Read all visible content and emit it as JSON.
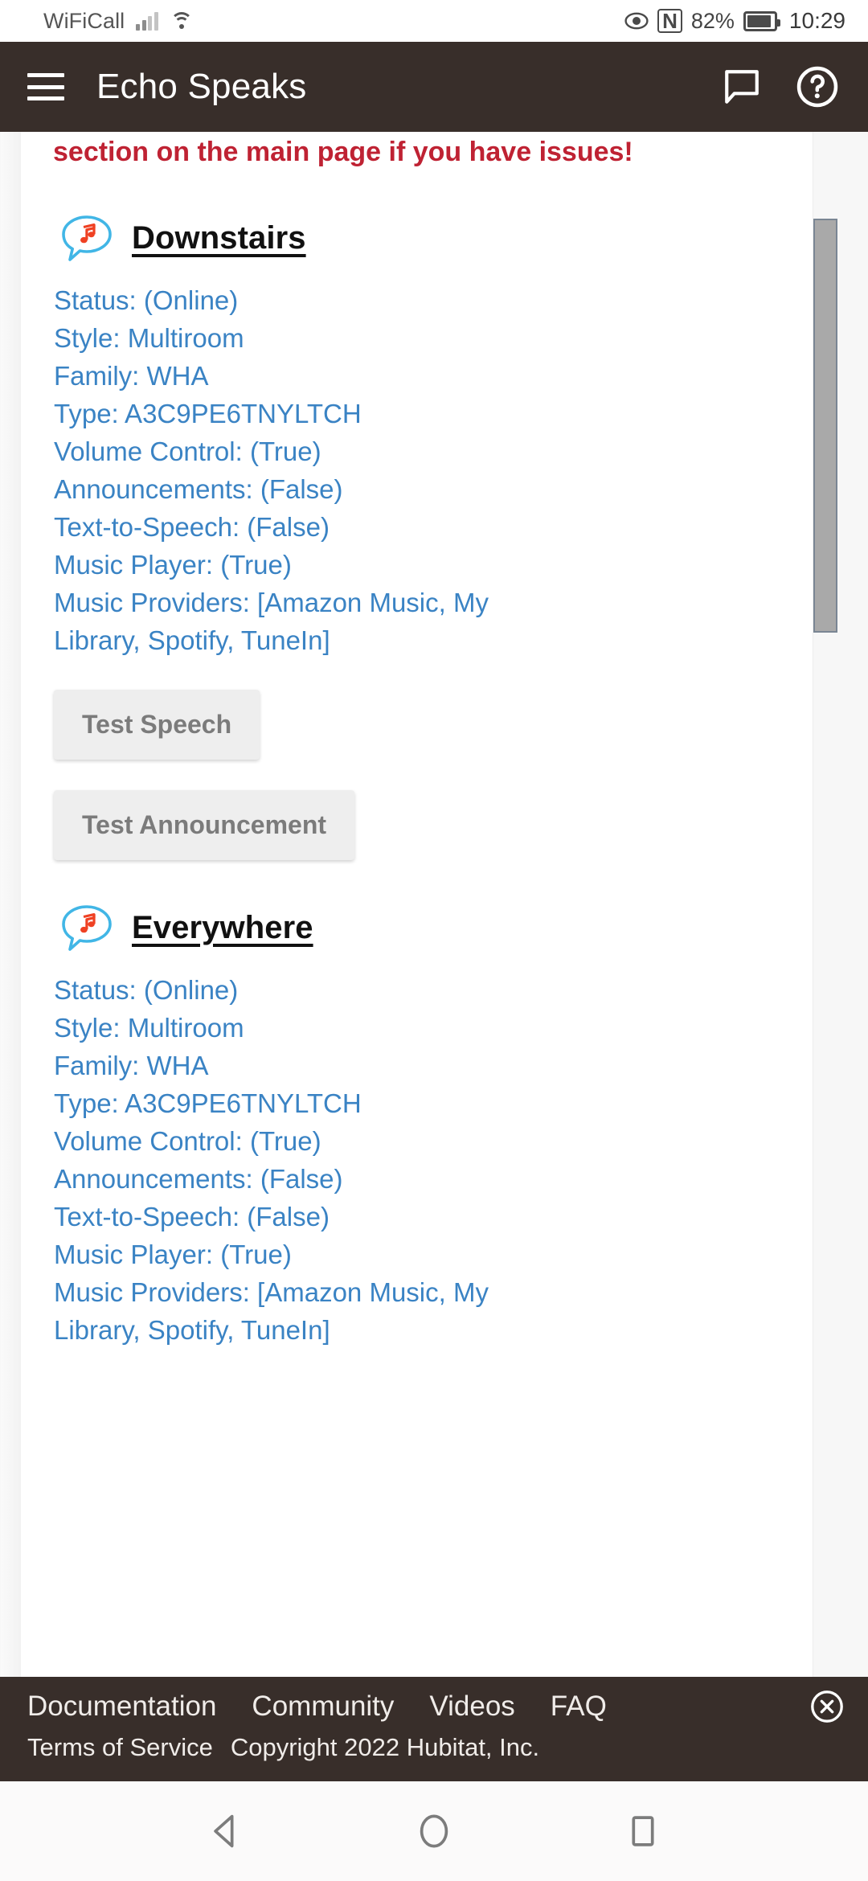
{
  "statusbar": {
    "carrier": "WiFiCall",
    "signal_icon": "signal-bars-icon",
    "wifi_icon": "wifi-icon",
    "eye_icon": "eye-icon",
    "nfc_icon": "nfc-icon",
    "nfc_label": "N",
    "battery_percent": "82%",
    "battery_icon": "battery-icon",
    "time": "10:29"
  },
  "appbar": {
    "menu_icon": "hamburger-menu-icon",
    "title": "Echo Speaks",
    "chat_icon": "chat-bubble-icon",
    "help_icon": "help-circle-icon"
  },
  "page": {
    "warning_text": "section on the main page if you have issues!",
    "warning_color": "#bf2233",
    "detail_color": "#3a83c4",
    "sections": [
      {
        "icon": "music-speech-bubble-icon",
        "title": "Downstairs",
        "details": [
          "Status: (Online)",
          "Style: Multiroom",
          "Family: WHA",
          "Type: A3C9PE6TNYLTCH",
          "Volume Control: (True)",
          "Announcements: (False)",
          "Text-to-Speech: (False)",
          "Music Player: (True)",
          "Music Providers: [Amazon Music, My Library, Spotify, TuneIn]"
        ],
        "buttons": [
          "Test Speech",
          "Test Announcement"
        ]
      },
      {
        "icon": "music-speech-bubble-icon",
        "title": "Everywhere",
        "details": [
          "Status: (Online)",
          "Style: Multiroom",
          "Family: WHA",
          "Type: A3C9PE6TNYLTCH",
          "Volume Control: (True)",
          "Announcements: (False)",
          "Text-to-Speech: (False)",
          "Music Player: (True)",
          "Music Providers: [Amazon Music, My Library, Spotify, TuneIn]"
        ],
        "buttons": []
      }
    ],
    "scrollbar": "vertical-scrollbar"
  },
  "footer": {
    "links": [
      "Documentation",
      "Community",
      "Videos",
      "FAQ"
    ],
    "close_icon": "close-circle-icon",
    "terms": "Terms of Service",
    "copyright": "Copyright 2022 Hubitat, Inc.",
    "background": "#382e2a"
  },
  "navbar": {
    "back_icon": "back-triangle-icon",
    "home_icon": "home-circle-icon",
    "recents_icon": "recents-square-icon"
  }
}
